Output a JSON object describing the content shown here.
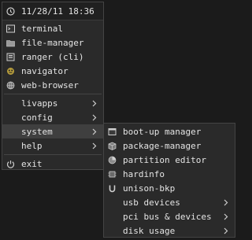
{
  "header": {
    "datetime": "11/28/11 18:36",
    "icon": "clock-icon"
  },
  "apps": [
    {
      "label": "terminal",
      "icon": "terminal-icon"
    },
    {
      "label": "file-manager",
      "icon": "folder-icon"
    },
    {
      "label": "ranger (cli)",
      "icon": "file-icon"
    },
    {
      "label": "navigator",
      "icon": "navigator-icon"
    },
    {
      "label": "web-browser",
      "icon": "globe-icon"
    }
  ],
  "submenus": [
    {
      "label": "livapps"
    },
    {
      "label": "config"
    },
    {
      "label": "system"
    },
    {
      "label": "help"
    }
  ],
  "exit": {
    "label": "exit",
    "icon": "power-icon"
  },
  "system_submenu": {
    "items": [
      {
        "label": "boot-up manager",
        "icon": "window-icon"
      },
      {
        "label": "package-manager",
        "icon": "package-icon"
      },
      {
        "label": "partition editor",
        "icon": "disk-icon"
      },
      {
        "label": "hardinfo",
        "icon": "chip-icon"
      },
      {
        "label": "unison-bkp",
        "icon": "unison-icon"
      }
    ],
    "folders": [
      {
        "label": "usb devices"
      },
      {
        "label": "pci bus & devices"
      },
      {
        "label": "disk usage"
      }
    ]
  },
  "colors": {
    "background": "#1b1b1b",
    "menu": "#2a2a2a",
    "highlight": "#3f3f3f",
    "text": "#e4e4e4"
  }
}
